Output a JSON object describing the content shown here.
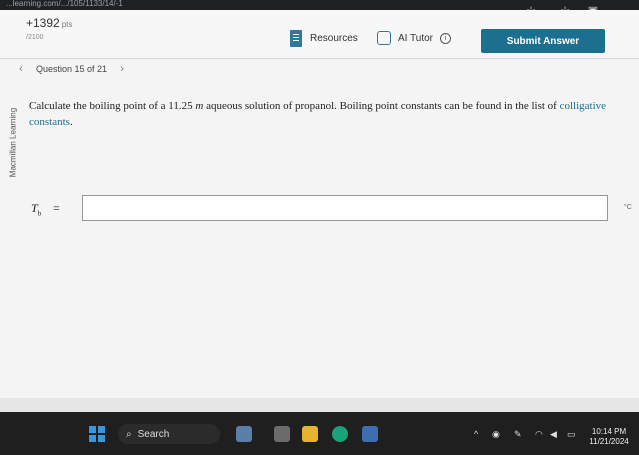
{
  "browser": {
    "url": "...learning.com/.../105/1133/14/-1"
  },
  "header": {
    "points": "+1392",
    "points_unit": "pts",
    "points_total": "/2100",
    "resources_label": "Resources",
    "ai_tutor_label": "AI Tutor",
    "submit_label": "Submit Answer"
  },
  "nav": {
    "question_label": "Question 15 of 21"
  },
  "sidebar": {
    "brand": "Macmillan Learning"
  },
  "question": {
    "text_before": "Calculate the boiling point of a 11.25 ",
    "molality_unit": "m",
    "text_middle": " aqueous solution of propanol. Boiling point constants can be found in the list of ",
    "link_text": "colligative constants",
    "text_after": "."
  },
  "answer": {
    "label_symbol": "T",
    "label_sub": "b",
    "equals": "=",
    "value": "",
    "unit": "°C"
  },
  "taskbar": {
    "search_label": "Search",
    "time": "10:14 PM",
    "date": "11/21/2024"
  },
  "colors": {
    "accent": "#1d6f8f",
    "start_blue": "#3a96dd"
  }
}
